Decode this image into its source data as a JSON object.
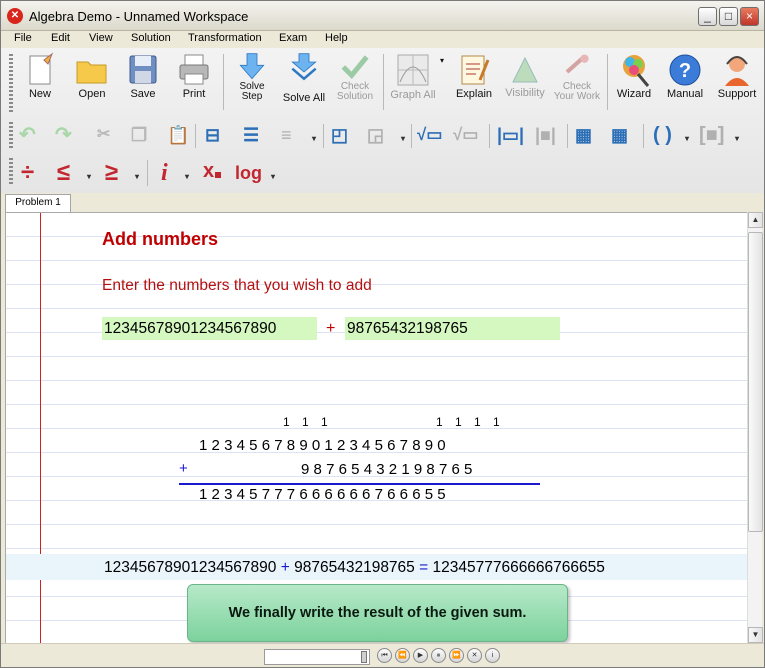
{
  "window": {
    "title": "Algebra Demo - Unnamed Workspace",
    "controls": [
      "_",
      "□",
      "×"
    ]
  },
  "menu": [
    "File",
    "Edit",
    "View",
    "Solution",
    "Transformation",
    "Exam",
    "Help"
  ],
  "toolbar": {
    "new": "New",
    "open": "Open",
    "save": "Save",
    "print": "Print",
    "solve_step": "Solve Step",
    "solve_all": "Solve All",
    "check_solution": "Check Solution",
    "graph_all": "Graph All",
    "explain": "Explain",
    "visibility": "Visibility",
    "check_work": "Check Your Work",
    "wizard": "Wizard",
    "manual": "Manual",
    "support": "Support",
    "row3": {
      "divide": "÷",
      "le": "≤",
      "ge": "≥",
      "imag": "i",
      "sub_x": "x",
      "log": "log"
    }
  },
  "tabs": [
    "Problem 1"
  ],
  "problem": {
    "heading": "Add numbers",
    "prompt": "Enter the numbers that you wish to add",
    "input_a": "12345678901234567890",
    "operator": "+",
    "input_b": "98765432198765",
    "carry_left": "1 1 1",
    "carry_right": "1 1 1 1",
    "addend_1": "12345678901234567890",
    "addend_2": "98765432198765",
    "sum": "12345777666666766655",
    "final_a": "12345678901234567890",
    "final_op": "+",
    "final_b": "98765432198765",
    "final_eq": "=",
    "final_result": "12345777666666766655",
    "callout": "We finally write the result of the given sum."
  },
  "colors": {
    "heading": "#c00000",
    "input_bg": "#d5f7c0",
    "operator_blue": "#1a1acc",
    "margin": "#cc2222",
    "callout": "#7cd29c"
  }
}
